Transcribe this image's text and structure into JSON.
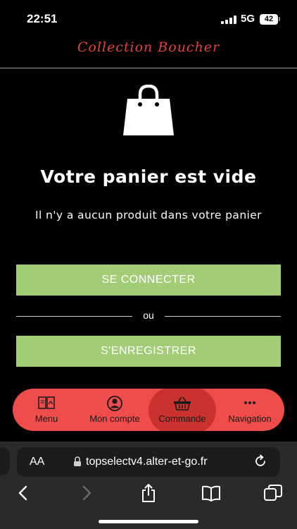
{
  "status_bar": {
    "time": "22:51",
    "network": "5G",
    "battery": "42"
  },
  "header": {
    "brand": "Collection Boucher"
  },
  "cart": {
    "icon": "shopping-bag-icon",
    "title": "Votre panier est vide",
    "subtitle": "Il n'y a aucun produit dans votre panier",
    "login_button": "SE CONNECTER",
    "separator": "ou",
    "register_button": "S'ENREGISTRER"
  },
  "app_nav": {
    "background": "#ef4c4c",
    "active_background": "#c9322f",
    "items": [
      {
        "label": "Menu",
        "icon": "book-menu-icon"
      },
      {
        "label": "Mon compte",
        "icon": "user-account-icon"
      },
      {
        "label": "Commande",
        "icon": "basket-icon",
        "active": true
      },
      {
        "label": "Navigation",
        "icon": "more-dots-icon"
      }
    ]
  },
  "browser": {
    "aa_label": "AA",
    "url": "topselectv4.alter-et-go.fr",
    "toolbar": [
      "back-icon",
      "forward-icon",
      "share-icon",
      "bookmarks-icon",
      "tabs-icon"
    ]
  },
  "colors": {
    "accent_red": "#e8423a",
    "button_green": "#a3cc76"
  }
}
